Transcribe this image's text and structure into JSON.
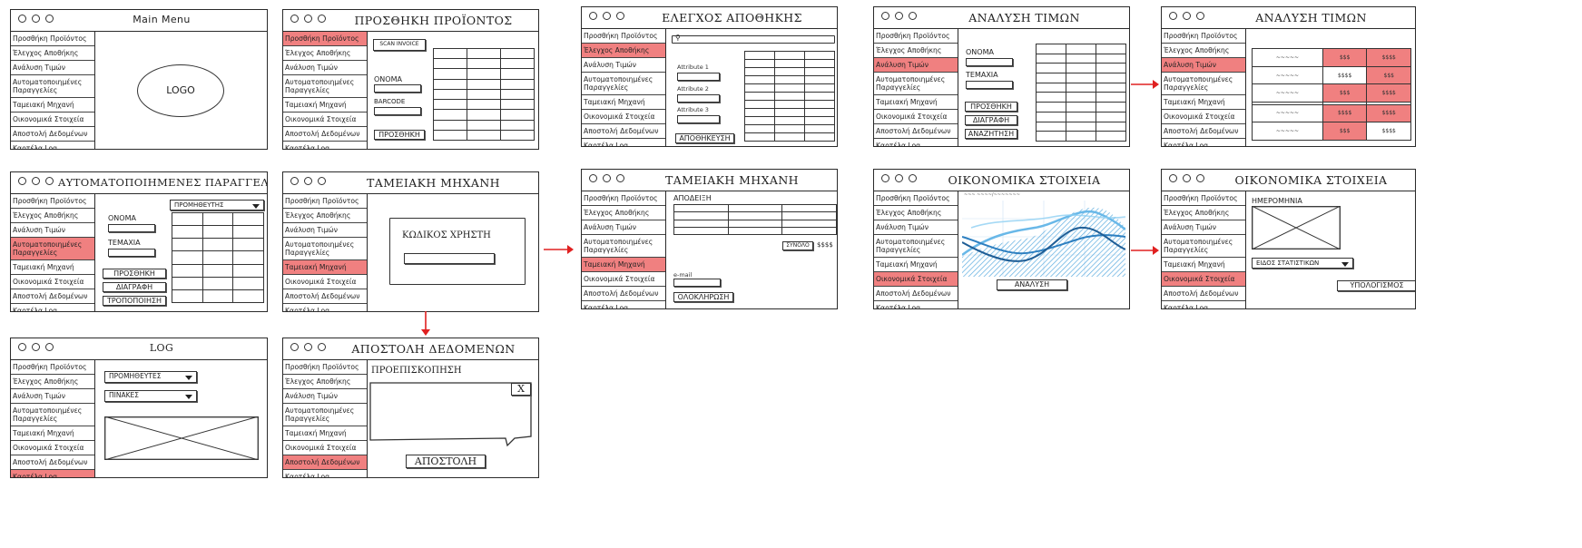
{
  "menu": [
    "Προσθήκη Προϊόντος",
    "Έλεγχος Αποθήκης",
    "Ανάλυση Τιμών",
    "Αυτοματοποιημένες Παραγγελίες",
    "Ταμειακή Μηχανή",
    "Οικονομικά Στοιχεία",
    "Αποστολή Δεδομένων",
    "Καρτέλα Log"
  ],
  "colors": {
    "highlight": "#f08080",
    "arrow": "#e02020",
    "chart_blue": "#3a9ad9"
  },
  "icons": {
    "dots": "three-window-dots",
    "arrow": "red-flow-arrow",
    "close": "x-close-icon"
  },
  "windows": {
    "main": {
      "title": "Main Menu",
      "logo": "LOGO"
    },
    "add_product": {
      "title": "ΠΡΟΣΘΗΚΗ ΠΡΟΪΟΝΤΟΣ",
      "scan": "SCAN INVOICE",
      "name": "ΟΝΟΜΑ",
      "barcode": "BARCODE",
      "add": "ΠΡΟΣΘΗΚΗ"
    },
    "warehouse": {
      "title": "ΕΛΕΓΧΟΣ ΑΠΟΘΗΚΗΣ",
      "attr1": "Attribute 1",
      "attr2": "Attribute 2",
      "attr3": "Attribute 3",
      "save": "ΑΠΟΘΗΚΕΥΣΗ"
    },
    "prices1": {
      "title": "ΑΝΑΛΥΣΗ ΤΙΜΩΝ",
      "name": "ΟΝΟΜΑ",
      "pieces": "ΤΕΜΑΧΙΑ",
      "add": "ΠΡΟΣΘΗΚΗ",
      "delete": "ΔΙΑΓΡΑΦΗ",
      "search": "ΑΝΑΖΗΤΗΣΗ"
    },
    "prices2": {
      "title": "ΑΝΑΛΥΣΗ ΤΙΜΩΝ",
      "rows": [
        [
          "~~~~~",
          "$$$",
          "$$$$"
        ],
        [
          "~~~~~",
          "$$$$",
          "$$$"
        ],
        [
          "~~~~~",
          "$$$",
          "$$$$"
        ],
        [
          "",
          "",
          ""
        ],
        [
          "~~~~~",
          "$$$$",
          "$$$$"
        ],
        [
          "~~~~~",
          "$$$",
          "$$$$"
        ]
      ]
    },
    "auto_orders": {
      "title": "ΑΥΤΟΜΑΤΟΠΟΙΗΜΕΝΕΣ ΠΑΡΑΓΓΕΛΙΕΣ",
      "supplier": "ΠΡΟΜΗΘΕΥΤΗΣ",
      "name": "ΟΝΟΜΑ",
      "pieces": "ΤΕΜΑΧΙΑ",
      "add": "ΠΡΟΣΘΗΚΗ",
      "delete": "ΔΙΑΓΡΑΦΗ",
      "edit": "ΤΡΟΠΟΠΟΙΗΣΗ"
    },
    "cash1": {
      "title": "ΤΑΜΕΙΑΚΗ ΜΗΧΑΝΗ",
      "user_code": "ΚΩΔΙΚΟΣ ΧΡΗΣΤΗ"
    },
    "cash2": {
      "title": "ΤΑΜΕΙΑΚΗ ΜΗΧΑΝΗ",
      "receipt": "ΑΠΟΔΕΙΞΗ",
      "total": "ΣΥΝΟΛΟ",
      "total_value": "$$$$",
      "email": "e-mail",
      "complete": "ΟΛΟΚΛΗΡΩΣΗ"
    },
    "finance1": {
      "title": "ΟΙΚΟΝΟΜΙΚΑ ΣΤΟΙΧΕΙΑ",
      "chart_caption": "~~~ ~~~~/~~~~~~~",
      "analysis": "ΑΝΑΛΥΣΗ"
    },
    "finance2": {
      "title": "ΟΙΚΟΝΟΜΙΚΑ ΣΤΟΙΧΕΙΑ",
      "date": "ΗΜΕΡΟΜΗΝΙΑ",
      "stats_type": "ΕΙΔΟΣ ΣΤΑΤΙΣΤΙΚΩΝ",
      "calc": "ΥΠΟΛΟΓΙΣΜΟΣ"
    },
    "log": {
      "title": "LOG",
      "suppliers": "ΠΡΟΜΗΘΕΥΤΕΣ",
      "tables": "ΠΙΝΑΚΕΣ"
    },
    "send": {
      "title": "ΑΠΟΣΤΟΛΗ ΔΕΔΟΜΕΝΩΝ",
      "preview": "ΠΡΟΕΠΙΣΚΟΠΗΣΗ",
      "close": "X",
      "send": "ΑΠΟΣΤΟΛΗ"
    }
  }
}
